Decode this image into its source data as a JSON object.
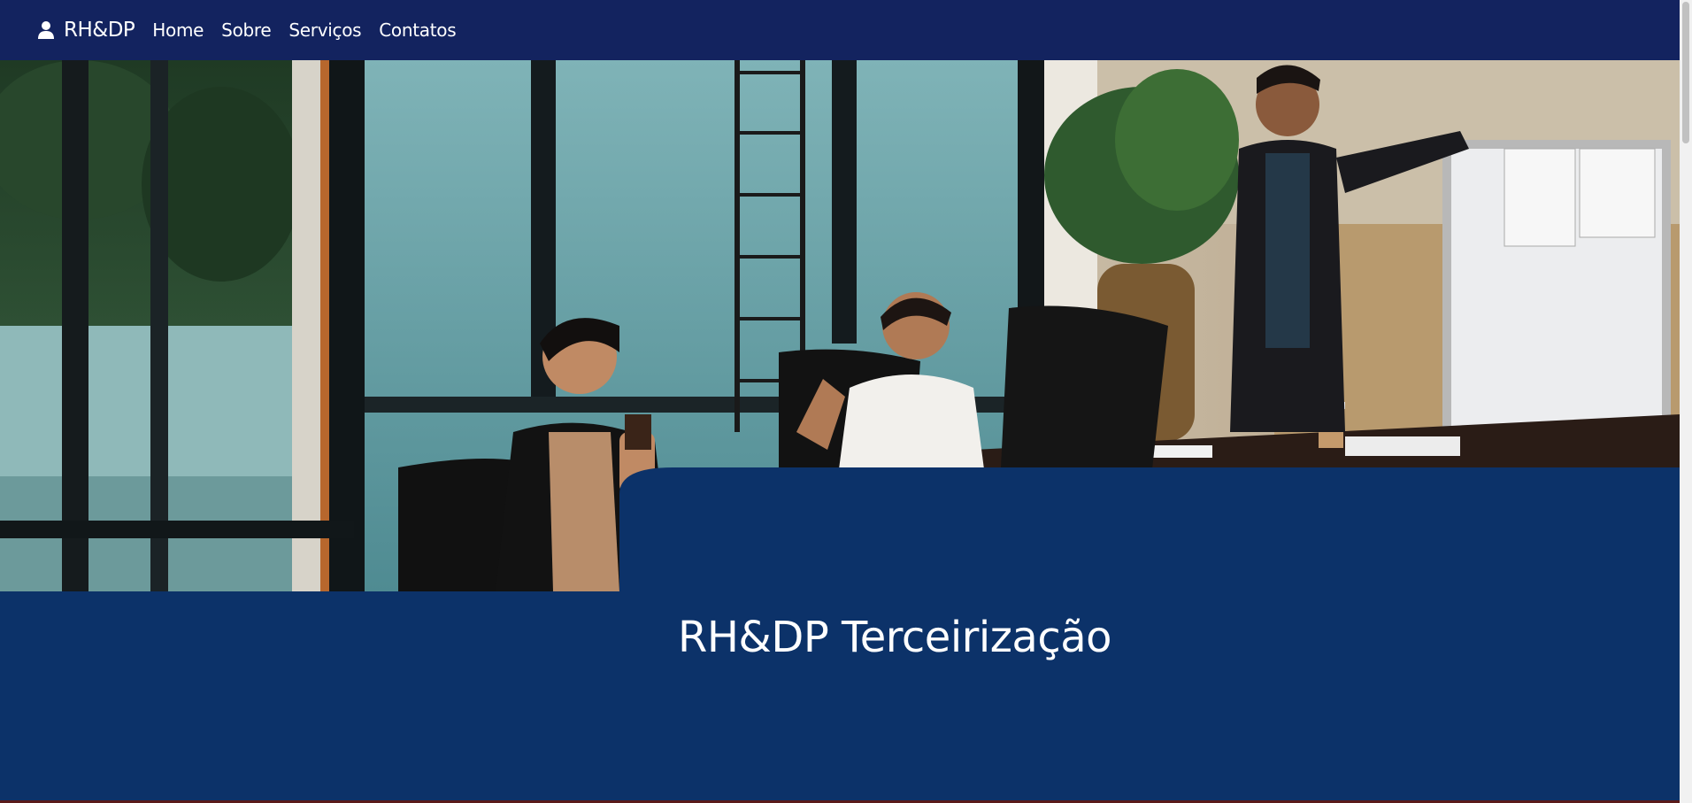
{
  "navbar": {
    "brand": "RH&DP",
    "brand_icon": "user-icon",
    "links": [
      "Home",
      "Sobre",
      "Serviços",
      "Contatos"
    ],
    "background_color": "#13235f"
  },
  "hero": {
    "image_description_icon": "office-meeting-photo",
    "overlay_color": "#0c3269"
  },
  "main": {
    "title": "RH&DP Terceirização"
  }
}
